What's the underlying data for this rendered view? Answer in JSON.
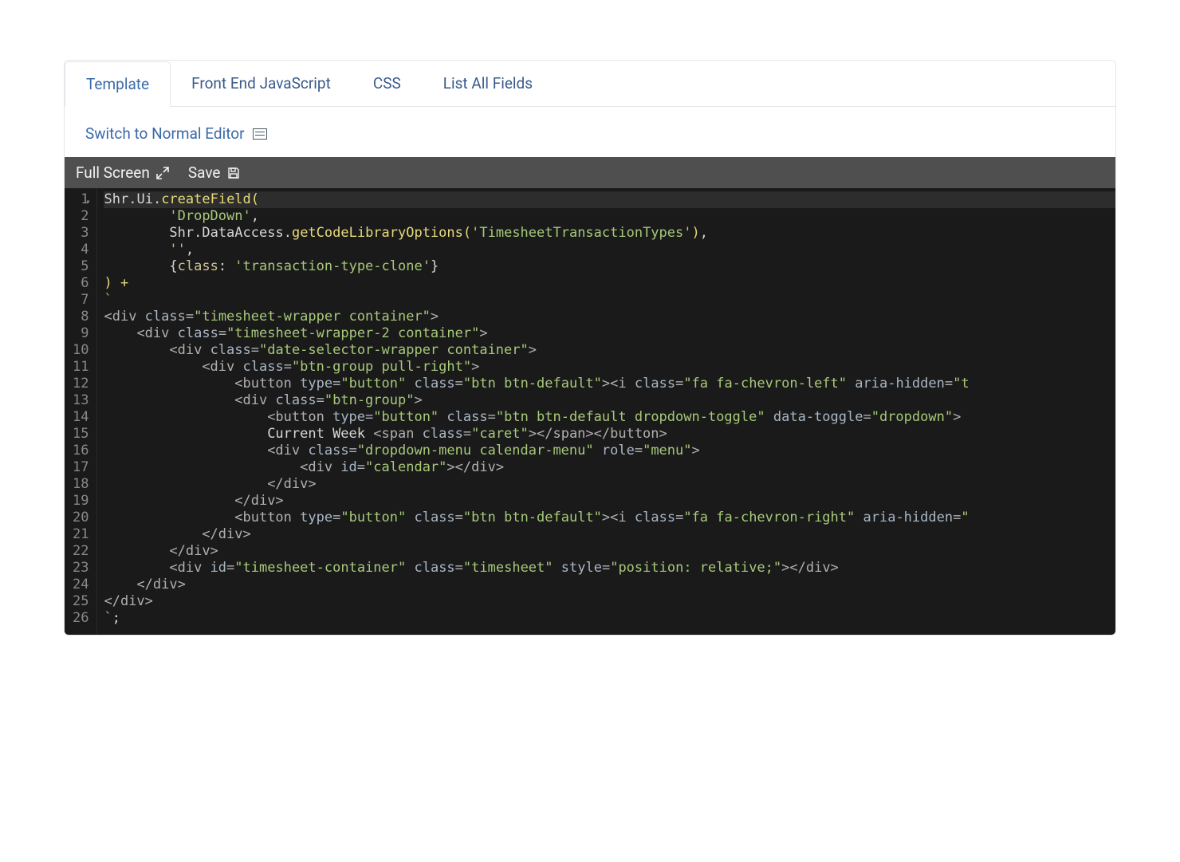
{
  "tabs": {
    "items": [
      {
        "label": "Template",
        "active": true
      },
      {
        "label": "Front End JavaScript",
        "active": false
      },
      {
        "label": "CSS",
        "active": false
      },
      {
        "label": "List All Fields",
        "active": false
      }
    ]
  },
  "switch_link": "Switch to Normal Editor",
  "toolbar": {
    "fullscreen": "Full Screen",
    "save": "Save"
  },
  "code": {
    "lines": [
      {
        "n": 1,
        "fold": true,
        "tokens": [
          [
            "id",
            "Shr"
          ],
          [
            "punc",
            "."
          ],
          [
            "id",
            "Ui"
          ],
          [
            "punc",
            "."
          ],
          [
            "fn",
            "createField"
          ],
          [
            "paren",
            "("
          ]
        ]
      },
      {
        "n": 2,
        "indent": 2,
        "tokens": [
          [
            "str",
            "'DropDown'"
          ],
          [
            "punc",
            ","
          ]
        ]
      },
      {
        "n": 3,
        "indent": 2,
        "tokens": [
          [
            "id",
            "Shr"
          ],
          [
            "punc",
            "."
          ],
          [
            "id",
            "DataAccess"
          ],
          [
            "punc",
            "."
          ],
          [
            "fn",
            "getCodeLibraryOptions"
          ],
          [
            "paren",
            "("
          ],
          [
            "str",
            "'TimesheetTransactionTypes'"
          ],
          [
            "paren",
            ")"
          ],
          [
            "punc",
            ","
          ]
        ]
      },
      {
        "n": 4,
        "indent": 2,
        "tokens": [
          [
            "str",
            "''"
          ],
          [
            "punc",
            ","
          ]
        ]
      },
      {
        "n": 5,
        "indent": 2,
        "tokens": [
          [
            "punc",
            "{"
          ],
          [
            "key",
            "class"
          ],
          [
            "punc",
            ": "
          ],
          [
            "str",
            "'transaction-type-clone'"
          ],
          [
            "punc",
            "}"
          ]
        ]
      },
      {
        "n": 6,
        "tokens": [
          [
            "paren",
            ")"
          ],
          [
            "punc",
            " "
          ],
          [
            "op",
            "+"
          ]
        ]
      },
      {
        "n": 7,
        "tokens": [
          [
            "tick",
            "`"
          ]
        ]
      },
      {
        "n": 8,
        "tokens": [
          [
            "tag",
            "<div "
          ],
          [
            "attr",
            "class"
          ],
          [
            "tag",
            "="
          ],
          [
            "val",
            "\"timesheet-wrapper container\""
          ],
          [
            "tag",
            ">"
          ]
        ]
      },
      {
        "n": 9,
        "indent": 1,
        "tokens": [
          [
            "tag",
            "<div "
          ],
          [
            "attr",
            "class"
          ],
          [
            "tag",
            "="
          ],
          [
            "val",
            "\"timesheet-wrapper-2 container\""
          ],
          [
            "tag",
            ">"
          ]
        ]
      },
      {
        "n": 10,
        "indent": 2,
        "tokens": [
          [
            "tag",
            "<div "
          ],
          [
            "attr",
            "class"
          ],
          [
            "tag",
            "="
          ],
          [
            "val",
            "\"date-selector-wrapper container\""
          ],
          [
            "tag",
            ">"
          ]
        ]
      },
      {
        "n": 11,
        "indent": 3,
        "tokens": [
          [
            "tag",
            "<div "
          ],
          [
            "attr",
            "class"
          ],
          [
            "tag",
            "="
          ],
          [
            "val",
            "\"btn-group pull-right\""
          ],
          [
            "tag",
            ">"
          ]
        ]
      },
      {
        "n": 12,
        "indent": 4,
        "tokens": [
          [
            "tag",
            "<button "
          ],
          [
            "attr",
            "type"
          ],
          [
            "tag",
            "="
          ],
          [
            "val",
            "\"button\""
          ],
          [
            "tag",
            " "
          ],
          [
            "attr",
            "class"
          ],
          [
            "tag",
            "="
          ],
          [
            "val",
            "\"btn btn-default\""
          ],
          [
            "tag",
            "><i "
          ],
          [
            "attr",
            "class"
          ],
          [
            "tag",
            "="
          ],
          [
            "val",
            "\"fa fa-chevron-left\""
          ],
          [
            "tag",
            " "
          ],
          [
            "attr",
            "aria-hidden"
          ],
          [
            "tag",
            "="
          ],
          [
            "val",
            "\"t"
          ]
        ]
      },
      {
        "n": 13,
        "indent": 4,
        "tokens": [
          [
            "tag",
            "<div "
          ],
          [
            "attr",
            "class"
          ],
          [
            "tag",
            "="
          ],
          [
            "val",
            "\"btn-group\""
          ],
          [
            "tag",
            ">"
          ]
        ]
      },
      {
        "n": 14,
        "indent": 5,
        "tokens": [
          [
            "tag",
            "<button "
          ],
          [
            "attr",
            "type"
          ],
          [
            "tag",
            "="
          ],
          [
            "val",
            "\"button\""
          ],
          [
            "tag",
            " "
          ],
          [
            "attr",
            "class"
          ],
          [
            "tag",
            "="
          ],
          [
            "val",
            "\"btn btn-default dropdown-toggle\""
          ],
          [
            "tag",
            " "
          ],
          [
            "attr",
            "data-toggle"
          ],
          [
            "tag",
            "="
          ],
          [
            "val",
            "\"dropdown\""
          ],
          [
            "tag",
            ">"
          ]
        ]
      },
      {
        "n": 15,
        "indent": 5,
        "tokens": [
          [
            "id",
            "Current Week "
          ],
          [
            "tag",
            "<span "
          ],
          [
            "attr",
            "class"
          ],
          [
            "tag",
            "="
          ],
          [
            "val",
            "\"caret\""
          ],
          [
            "tag",
            "></span></button>"
          ]
        ]
      },
      {
        "n": 16,
        "indent": 5,
        "tokens": [
          [
            "tag",
            "<div "
          ],
          [
            "attr",
            "class"
          ],
          [
            "tag",
            "="
          ],
          [
            "val",
            "\"dropdown-menu calendar-menu\""
          ],
          [
            "tag",
            " "
          ],
          [
            "attr",
            "role"
          ],
          [
            "tag",
            "="
          ],
          [
            "val",
            "\"menu\""
          ],
          [
            "tag",
            ">"
          ]
        ]
      },
      {
        "n": 17,
        "indent": 6,
        "tokens": [
          [
            "tag",
            "<div "
          ],
          [
            "attr",
            "id"
          ],
          [
            "tag",
            "="
          ],
          [
            "val",
            "\"calendar\""
          ],
          [
            "tag",
            "></div>"
          ]
        ]
      },
      {
        "n": 18,
        "indent": 5,
        "tokens": [
          [
            "tag",
            "</div>"
          ]
        ]
      },
      {
        "n": 19,
        "indent": 4,
        "tokens": [
          [
            "tag",
            "</div>"
          ]
        ]
      },
      {
        "n": 20,
        "indent": 4,
        "tokens": [
          [
            "tag",
            "<button "
          ],
          [
            "attr",
            "type"
          ],
          [
            "tag",
            "="
          ],
          [
            "val",
            "\"button\""
          ],
          [
            "tag",
            " "
          ],
          [
            "attr",
            "class"
          ],
          [
            "tag",
            "="
          ],
          [
            "val",
            "\"btn btn-default\""
          ],
          [
            "tag",
            "><i "
          ],
          [
            "attr",
            "class"
          ],
          [
            "tag",
            "="
          ],
          [
            "val",
            "\"fa fa-chevron-right\""
          ],
          [
            "tag",
            " "
          ],
          [
            "attr",
            "aria-hidden"
          ],
          [
            "tag",
            "="
          ],
          [
            "val",
            "\""
          ]
        ]
      },
      {
        "n": 21,
        "indent": 3,
        "tokens": [
          [
            "tag",
            "</div>"
          ]
        ]
      },
      {
        "n": 22,
        "indent": 2,
        "tokens": [
          [
            "tag",
            "</div>"
          ]
        ]
      },
      {
        "n": 23,
        "indent": 2,
        "tokens": [
          [
            "tag",
            "<div "
          ],
          [
            "attr",
            "id"
          ],
          [
            "tag",
            "="
          ],
          [
            "val",
            "\"timesheet-container\""
          ],
          [
            "tag",
            " "
          ],
          [
            "attr",
            "class"
          ],
          [
            "tag",
            "="
          ],
          [
            "val",
            "\"timesheet\""
          ],
          [
            "tag",
            " "
          ],
          [
            "attr",
            "style"
          ],
          [
            "tag",
            "="
          ],
          [
            "val",
            "\"position: relative;\""
          ],
          [
            "tag",
            "></div>"
          ]
        ]
      },
      {
        "n": 24,
        "indent": 1,
        "tokens": [
          [
            "tag",
            "</div>"
          ]
        ]
      },
      {
        "n": 25,
        "tokens": [
          [
            "tag",
            "</div>"
          ]
        ]
      },
      {
        "n": 26,
        "tokens": [
          [
            "tick",
            "`"
          ],
          [
            "punc",
            ";"
          ]
        ]
      }
    ]
  }
}
